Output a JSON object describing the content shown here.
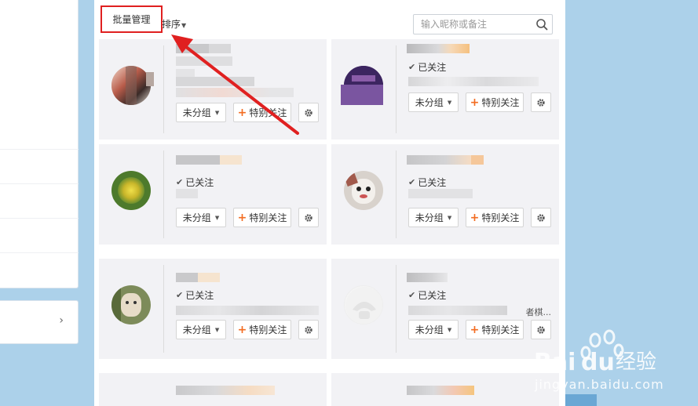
{
  "toolbar": {
    "batch_label": "批量管理",
    "sort_label": "排序",
    "search_placeholder": "输入昵称或备注"
  },
  "cards": [
    {
      "followed": "",
      "group": "未分组",
      "special": "特别关注",
      "extra": ""
    },
    {
      "followed": "已关注",
      "group": "未分组",
      "special": "特别关注",
      "extra": ""
    },
    {
      "followed": "已关注",
      "group": "未分组",
      "special": "特别关注",
      "extra": ""
    },
    {
      "followed": "已关注",
      "group": "未分组",
      "special": "特别关注",
      "extra": ""
    },
    {
      "followed": "已关注",
      "group": "未分组",
      "special": "特别关注",
      "extra": ""
    },
    {
      "followed": "已关注",
      "group": "未分组",
      "special": "特别关注",
      "extra": "者棋..."
    }
  ],
  "watermark": {
    "brand": "Baidu经验",
    "url": "jingyan.baidu.com"
  },
  "colors": {
    "highlight_box": "#e02020",
    "arrow": "#e02020",
    "accent_plus": "#f36c21",
    "page_bg": "#acd1ea"
  }
}
